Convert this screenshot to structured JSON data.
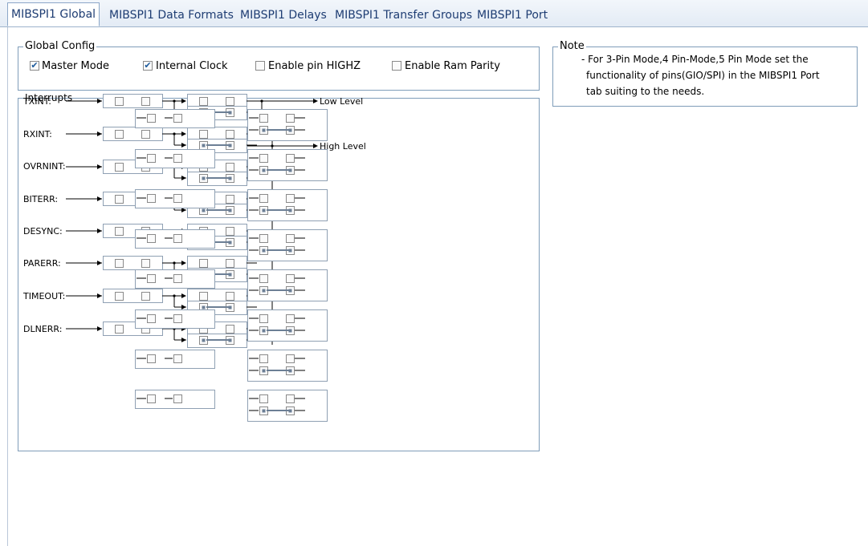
{
  "tabs": [
    {
      "label": "MIBSPI1 Global",
      "active": true
    },
    {
      "label": "MIBSPI1 Data Formats",
      "active": false
    },
    {
      "label": "MIBSPI1 Delays",
      "active": false
    },
    {
      "label": "MIBSPI1 Transfer Groups",
      "active": false
    },
    {
      "label": "MIBSPI1 Port",
      "active": false
    }
  ],
  "global_config": {
    "title": "Global Config",
    "options": [
      {
        "label": "Master Mode",
        "checked": true
      },
      {
        "label": "Internal Clock",
        "checked": true
      },
      {
        "label": "Enable pin HIGHZ",
        "checked": false
      },
      {
        "label": "Enable Ram Parity",
        "checked": false
      }
    ]
  },
  "note": {
    "title": "Note",
    "lines": [
      "- For 3-Pin Mode,4 Pin-Mode,5 Pin Mode set the",
      "functionality of pins(GIO/SPI) in the MIBSPI1 Port",
      "tab suiting to the needs."
    ]
  },
  "interrupts": {
    "title": "Interrupts",
    "rows": [
      "TXINT:",
      "RXINT:",
      "OVRNINT:",
      "BITERR:",
      "DESYNC:",
      "PARERR:",
      "TIMEOUT:",
      "DLNERR:"
    ],
    "low_level": "Low Level",
    "high_level": "High Level"
  },
  "colors": {
    "tab_text": "#1e3d73",
    "group_border": "#7f9db9",
    "wire": "#000000",
    "switch_link": "#6c7f95"
  }
}
